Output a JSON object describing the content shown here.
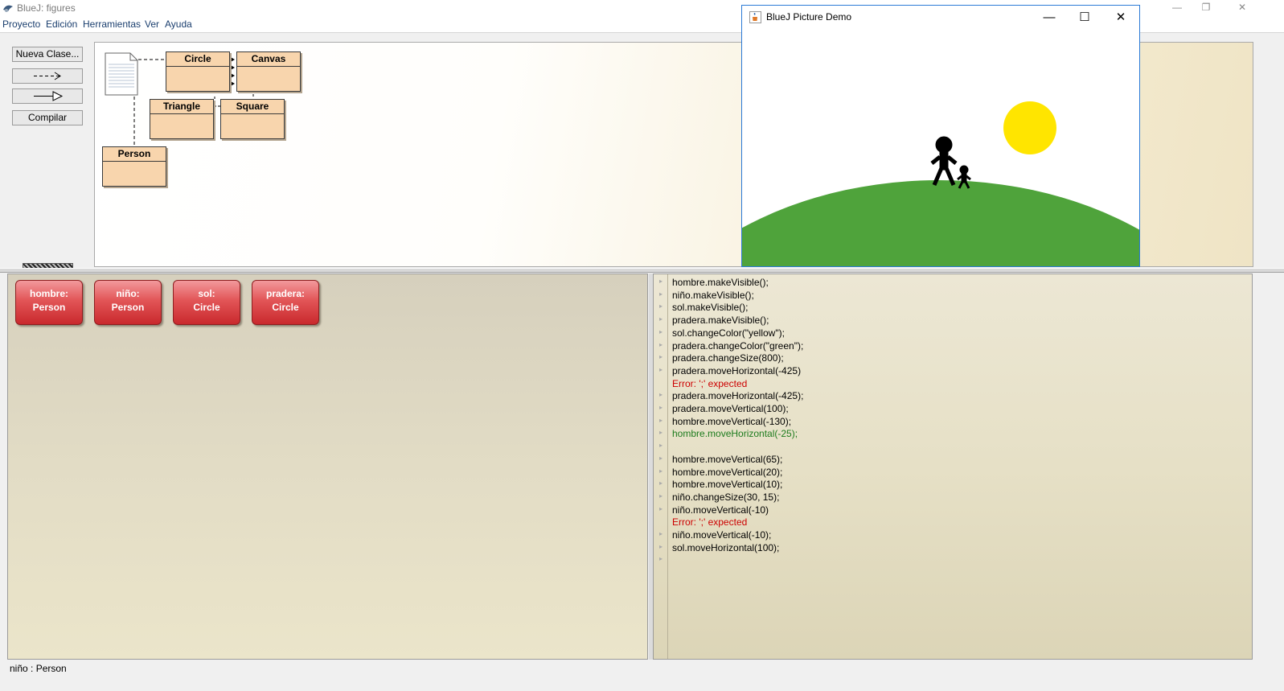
{
  "window": {
    "title": "BlueJ:  figures",
    "controls": {
      "minimize": "—",
      "restore": "❐",
      "close": "✕"
    }
  },
  "menu": [
    "Proyecto",
    "Edición",
    "Herramientas",
    "Ver",
    "Ayuda"
  ],
  "toolbar": {
    "new_class": "Nueva Clase...",
    "uses_arrow": "--->",
    "inherits_arrow": "—▷",
    "compile": "Compilar"
  },
  "classes": {
    "circle": "Circle",
    "canvas": "Canvas",
    "triangle": "Triangle",
    "square": "Square",
    "person": "Person"
  },
  "objects": [
    {
      "name": "hombre:",
      "type": "Person"
    },
    {
      "name": "niño:",
      "type": "Person"
    },
    {
      "name": "sol:",
      "type": "Circle"
    },
    {
      "name": "pradera:",
      "type": "Circle"
    }
  ],
  "codepad": [
    {
      "text": "hombre.makeVisible();",
      "kind": "code"
    },
    {
      "text": "niño.makeVisible();",
      "kind": "code"
    },
    {
      "text": "sol.makeVisible();",
      "kind": "code"
    },
    {
      "text": "pradera.makeVisible();",
      "kind": "code"
    },
    {
      "text": "sol.changeColor(\"yellow\");",
      "kind": "code"
    },
    {
      "text": "pradera.changeColor(\"green\");",
      "kind": "code"
    },
    {
      "text": "pradera.changeSize(800);",
      "kind": "code"
    },
    {
      "text": "pradera.moveHorizontal(-425)",
      "kind": "code"
    },
    {
      "text": "Error: ';' expected",
      "kind": "error"
    },
    {
      "text": "pradera.moveHorizontal(-425);",
      "kind": "code"
    },
    {
      "text": "pradera.moveVertical(100);",
      "kind": "code"
    },
    {
      "text": "hombre.moveVertical(-130);",
      "kind": "code"
    },
    {
      "text": "hombre.moveHorizontal(-25);",
      "kind": "ok"
    },
    {
      "text": "",
      "kind": "code"
    },
    {
      "text": "hombre.moveVertical(65);",
      "kind": "code"
    },
    {
      "text": "hombre.moveVertical(20);",
      "kind": "code"
    },
    {
      "text": "hombre.moveVertical(10);",
      "kind": "code"
    },
    {
      "text": "niño.changeSize(30, 15);",
      "kind": "code"
    },
    {
      "text": "niño.moveVertical(-10)",
      "kind": "code"
    },
    {
      "text": "Error: ';' expected",
      "kind": "error"
    },
    {
      "text": "niño.moveVertical(-10);",
      "kind": "code"
    },
    {
      "text": "sol.moveHorizontal(100);",
      "kind": "code"
    },
    {
      "text": "",
      "kind": "code"
    }
  ],
  "status": "niño : Person",
  "picture_window": {
    "title": "BlueJ Picture Demo",
    "controls": {
      "minimize": "—",
      "maximize": "☐",
      "close": "✕"
    },
    "colors": {
      "sun": "#ffe500",
      "meadow": "#4fa33b",
      "figures": "#000000",
      "sky": "#ffffff"
    }
  }
}
